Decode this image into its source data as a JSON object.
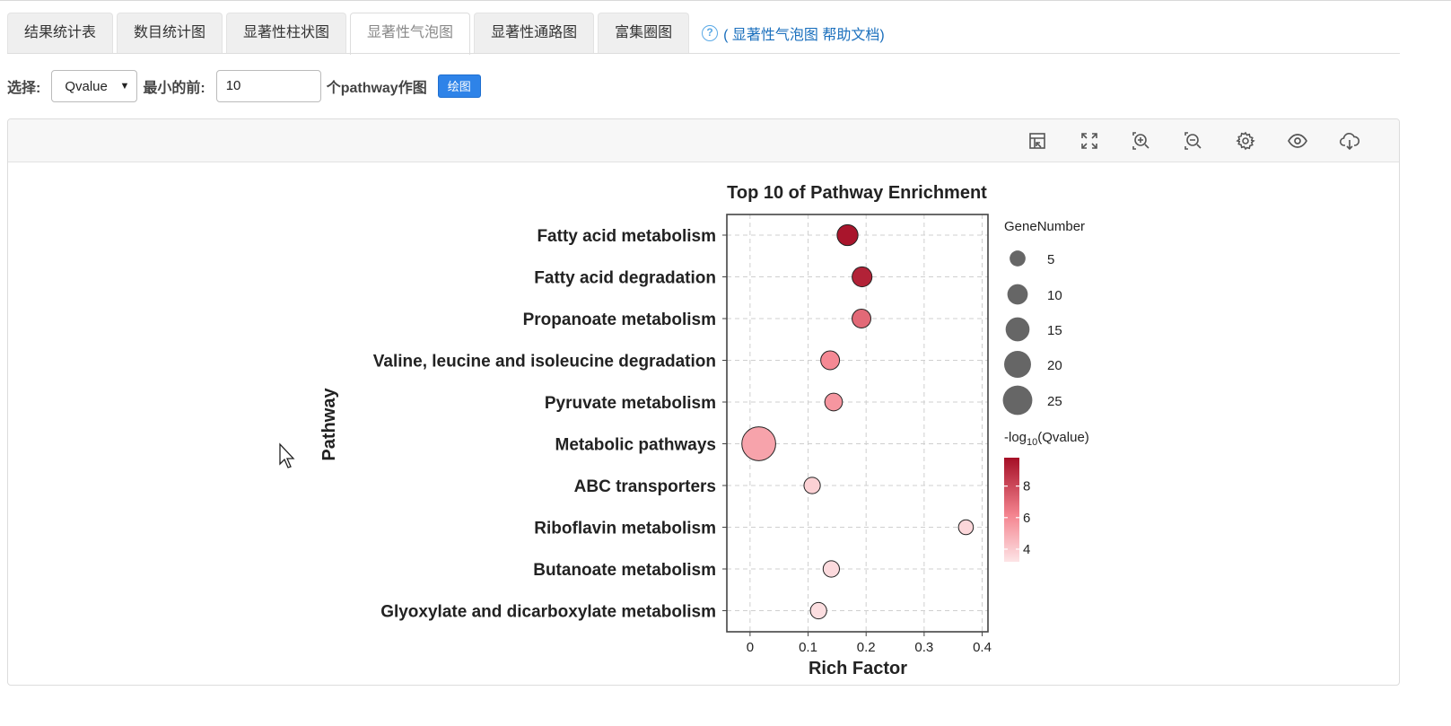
{
  "tabs": [
    {
      "label": "结果统计表"
    },
    {
      "label": "数目统计图"
    },
    {
      "label": "显著性柱状图"
    },
    {
      "label": "显著性气泡图"
    },
    {
      "label": "显著性通路图"
    },
    {
      "label": "富集圈图"
    }
  ],
  "help_link": "( 显著性气泡图 帮助文档)",
  "controls": {
    "select_label": "选择:",
    "select_value": "Qvalue",
    "min_label": "最小的前:",
    "min_value": "10",
    "suffix": "个pathway作图",
    "draw_button": "绘图"
  },
  "toolbar_icons": [
    "restore-icon",
    "fullscreen-icon",
    "zoom-in-icon",
    "zoom-out-icon",
    "gear-icon",
    "eye-icon",
    "cloud-download-icon"
  ],
  "chart_data": {
    "type": "scatter",
    "title": "Top 10 of Pathway Enrichment",
    "xlabel": "Rich Factor",
    "ylabel": "Pathway",
    "xlim": [
      -0.04,
      0.41
    ],
    "xticks": [
      0,
      0.1,
      0.2,
      0.3,
      0.4
    ],
    "xtick_labels": [
      "0",
      "0.1",
      "0.2",
      "0.3",
      "0.4"
    ],
    "grid": true,
    "legend_position": "right",
    "size_legend": {
      "title": "GeneNumber",
      "values": [
        5,
        10,
        15,
        20,
        25
      ],
      "labels": [
        "5",
        "10",
        "15",
        "20",
        "25"
      ]
    },
    "color_legend": {
      "title_parts": [
        "-log",
        "10",
        "(Qvalue)"
      ],
      "range": [
        3.2,
        9.8
      ],
      "ticks": [
        4,
        6,
        8
      ],
      "tick_labels": [
        "4",
        "6",
        "8"
      ],
      "low_color": "#fde4e6",
      "high_color": "#a50f26"
    },
    "categories": [
      "Fatty acid metabolism",
      "Fatty acid degradation",
      "Propanoate metabolism",
      "Valine, leucine and isoleucine degradation",
      "Pyruvate metabolism",
      "Metabolic pathways",
      "ABC transporters",
      "Riboflavin metabolism",
      "Butanoate metabolism",
      "Glyoxylate and dicarboxylate metabolism"
    ],
    "points": [
      {
        "pathway": "Fatty acid metabolism",
        "rich_factor": 0.168,
        "gene_number": 8,
        "neg_log10_q": 9.6
      },
      {
        "pathway": "Fatty acid degradation",
        "rich_factor": 0.193,
        "gene_number": 7,
        "neg_log10_q": 9.2
      },
      {
        "pathway": "Propanoate metabolism",
        "rich_factor": 0.192,
        "gene_number": 6,
        "neg_log10_q": 7.0
      },
      {
        "pathway": "Valine, leucine and isoleucine degradation",
        "rich_factor": 0.138,
        "gene_number": 6,
        "neg_log10_q": 6.0
      },
      {
        "pathway": "Pyruvate metabolism",
        "rich_factor": 0.144,
        "gene_number": 5,
        "neg_log10_q": 5.6
      },
      {
        "pathway": "Metabolic pathways",
        "rich_factor": 0.015,
        "gene_number": 27,
        "neg_log10_q": 5.2
      },
      {
        "pathway": "ABC transporters",
        "rich_factor": 0.107,
        "gene_number": 4,
        "neg_log10_q": 3.8
      },
      {
        "pathway": "Riboflavin metabolism",
        "rich_factor": 0.372,
        "gene_number": 3,
        "neg_log10_q": 3.6
      },
      {
        "pathway": "Butanoate metabolism",
        "rich_factor": 0.14,
        "gene_number": 4,
        "neg_log10_q": 3.5
      },
      {
        "pathway": "Glyoxylate and dicarboxylate metabolism",
        "rich_factor": 0.118,
        "gene_number": 4,
        "neg_log10_q": 3.4
      }
    ]
  }
}
